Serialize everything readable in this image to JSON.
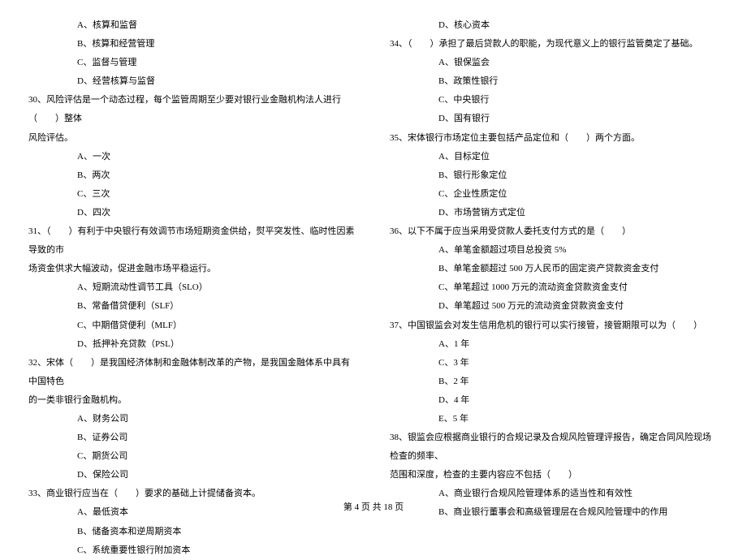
{
  "left": {
    "opt29": [
      "A、核算和监督",
      "B、核算和经营管理",
      "C、监督与管理",
      "D、经营核算与监督"
    ],
    "q30": "30、风险评估是一个动态过程，每个监管周期至少要对银行业金融机构法人进行（　　）整体",
    "q30_cont": "风险评估。",
    "opt30": [
      "A、一次",
      "B、两次",
      "C、三次",
      "D、四次"
    ],
    "q31": "31、（　　）有利于中央银行有效调节市场短期资金供给，熨平突发性、临时性因素导致的市",
    "q31_cont": "场资金供求大幅波动，促进金融市场平稳运行。",
    "opt31": [
      "A、短期流动性调节工具（SLO）",
      "B、常备借贷便利（SLF）",
      "C、中期借贷便利（MLF）",
      "D、抵押补充贷款（PSL）"
    ],
    "q32": "32、宋体（　　）是我国经济体制和金融体制改革的产物，是我国金融体系中具有中国特色",
    "q32_cont": "的一类非银行金融机构。",
    "opt32": [
      "A、财务公司",
      "B、证券公司",
      "C、期货公司",
      "D、保险公司"
    ],
    "q33": "33、商业银行应当在（　　）要求的基础上计提储备资本。",
    "opt33": [
      "A、最低资本",
      "B、储备资本和逆周期资本",
      "C、系统重要性银行附加资本"
    ]
  },
  "right": {
    "opt33d": "D、核心资本",
    "q34": "34、（　　）承担了最后贷款人的职能，为现代意义上的银行监管奠定了基础。",
    "opt34": [
      "A、银保监会",
      "B、政策性银行",
      "C、中央银行",
      "D、国有银行"
    ],
    "q35": "35、宋体银行市场定位主要包括产品定位和（　　）两个方面。",
    "opt35": [
      "A、目标定位",
      "B、银行形象定位",
      "C、企业性质定位",
      "D、市场营销方式定位"
    ],
    "q36": "36、以下不属于应当采用受贷款人委托支付方式的是（　　）",
    "opt36": [
      "A、单笔金额超过项目总投资 5%",
      "B、单笔金额超过 500 万人民币的固定资产贷款资金支付",
      "C、单笔超过 1000 万元的流动资金贷款资金支付",
      "D、单笔超过 500 万元的流动资金贷款资金支付"
    ],
    "q37": "37、中国银监会对发生信用危机的银行可以实行接管，接管期限可以为（　　）",
    "opt37": [
      "A、1 年",
      "C、3 年",
      "B、2 年",
      "D、4 年",
      "E、5 年"
    ],
    "q38": "38、银监会应根据商业银行的合规记录及合规风险管理评报告，确定合同风险现场检查的频率、",
    "q38_cont": "范围和深度，检查的主要内容应不包括（　　）",
    "opt38": [
      "A、商业银行合规风险管理体系的适当性和有效性",
      "B、商业银行董事会和高级管理层在合规风险管理中的作用"
    ]
  },
  "footer": "第 4 页 共 18 页"
}
